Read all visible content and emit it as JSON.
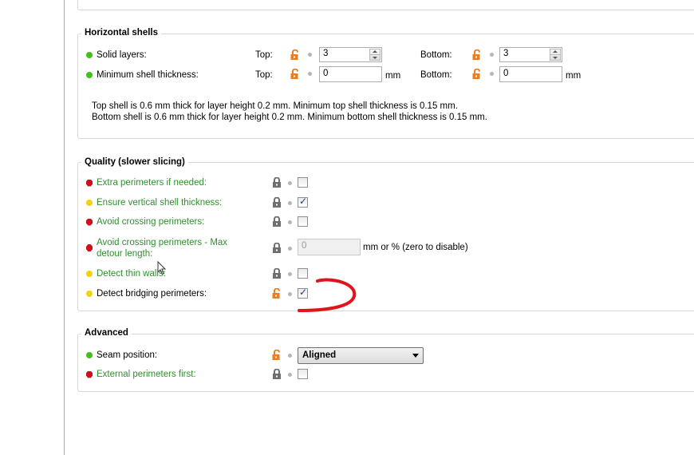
{
  "horizontal_shells": {
    "title": "Horizontal shells",
    "solid_layers": {
      "label": "Solid layers:",
      "top_label": "Top:",
      "top_value": "3",
      "bottom_label": "Bottom:",
      "bottom_value": "3"
    },
    "min_shell_thickness": {
      "label": "Minimum shell thickness:",
      "top_label": "Top:",
      "top_value": "0",
      "top_unit": "mm",
      "bottom_label": "Bottom:",
      "bottom_value": "0",
      "bottom_unit": "mm"
    },
    "info_line1": "Top shell is 0.6 mm thick for layer height 0.2 mm. Minimum top shell thickness is 0.15 mm.",
    "info_line2": "Bottom shell is 0.6 mm thick for layer height 0.2 mm. Minimum bottom shell thickness is 0.15 mm."
  },
  "quality": {
    "title": "Quality (slower slicing)",
    "extra_perimeters": {
      "label": "Extra perimeters if needed:",
      "checked": false
    },
    "ensure_vertical": {
      "label": "Ensure vertical shell thickness:",
      "checked": true
    },
    "avoid_crossing": {
      "label": "Avoid crossing perimeters:",
      "checked": false
    },
    "avoid_crossing_max": {
      "label_line1": "Avoid crossing perimeters - Max",
      "label_line2": "detour length:",
      "value": "0",
      "unit": "mm or % (zero to disable)"
    },
    "detect_thin_walls": {
      "label": "Detect thin walls:",
      "checked": false
    },
    "detect_bridging": {
      "label": "Detect bridging perimeters:",
      "checked": true
    }
  },
  "advanced": {
    "title": "Advanced",
    "seam_position": {
      "label": "Seam position:",
      "value": "Aligned"
    },
    "external_first": {
      "label": "External perimeters first:",
      "checked": false
    }
  },
  "colors": {
    "accent_orange": "#ee7d1d",
    "lock_gray": "#6f6f6f",
    "annotation_red": "#e0141c"
  }
}
